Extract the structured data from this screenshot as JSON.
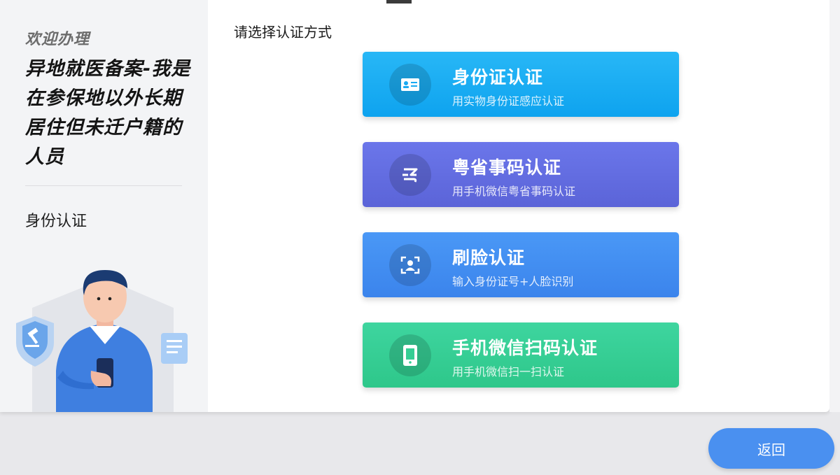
{
  "sidebar": {
    "welcome": "欢迎办理",
    "service_title": "异地就医备案-我是在参保地以外长期居住但未迁户籍的人员",
    "step_label": "身份认证"
  },
  "main": {
    "prompt": "请选择认证方式",
    "options": [
      {
        "title": "身份证认证",
        "subtitle": "用实物身份证感应认证",
        "icon": "id-card-icon",
        "color": "#1aaaf2"
      },
      {
        "title": "粤省事码认证",
        "subtitle": "用手机微信粤省事码认证",
        "icon": "yue-code-icon",
        "color": "#626ddf"
      },
      {
        "title": "刷脸认证",
        "subtitle": "输入身份证号+人脸识别",
        "icon": "face-scan-icon",
        "color": "#428df1"
      },
      {
        "title": "手机微信扫码认证",
        "subtitle": "用手机微信扫一扫认证",
        "icon": "phone-icon",
        "color": "#35ce94"
      }
    ]
  },
  "footer": {
    "back_label": "返回"
  }
}
